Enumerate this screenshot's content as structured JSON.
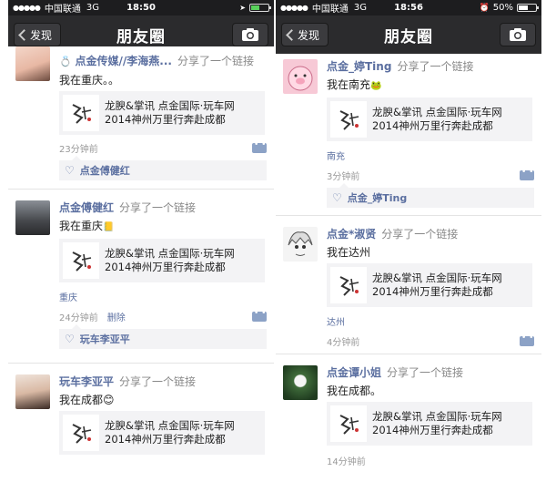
{
  "left": {
    "status": {
      "carrier": "中国联通",
      "network": "3G",
      "time": "18:50",
      "battery_level": 0.5
    },
    "nav": {
      "back": "发现",
      "title": "朋友圈"
    },
    "posts": [
      {
        "nick": "点金传媒//李海燕...",
        "action": "分享了一个链接",
        "text": "我在重庆。。",
        "link": "龙腴&掌讯 点金国际·玩车网 2014神州万里行奔赴成都",
        "location": "",
        "time": "23分钟前",
        "delete": "",
        "likes": "点金傅健红"
      },
      {
        "nick": "点金傅健红",
        "action": "分享了一个链接",
        "text": "我在重庆",
        "link": "龙腴&掌讯 点金国际·玩车网 2014神州万里行奔赴成都",
        "location": "重庆",
        "time": "24分钟前",
        "delete": "删除",
        "likes": "玩车李亚平"
      },
      {
        "nick": "玩车李亚平",
        "action": "分享了一个链接",
        "text": "我在成都😊",
        "link": "龙腴&掌讯 点金国际·玩车网 2014神州万里行奔赴成都",
        "location": "",
        "time": "",
        "delete": "",
        "likes": ""
      }
    ]
  },
  "right": {
    "status": {
      "carrier": "中国联通",
      "network": "3G",
      "time": "18:56",
      "battery": "50%"
    },
    "nav": {
      "back": "发现",
      "title": "朋友圈"
    },
    "posts": [
      {
        "nick": "点金_婷Ting",
        "action": "分享了一个链接",
        "text": "我在南充",
        "link": "龙腴&掌讯 点金国际·玩车网 2014神州万里行奔赴成都",
        "location": "南充",
        "time": "3分钟前",
        "likes": "点金_婷Ting"
      },
      {
        "nick": "点金*淑贤",
        "action": "分享了一个链接",
        "text": "我在达州",
        "link": "龙腴&掌讯 点金国际·玩车网 2014神州万里行奔赴成都",
        "location": "达州",
        "time": "4分钟前",
        "likes": ""
      },
      {
        "nick": "点金谭小姐",
        "action": "分享了一个链接",
        "text": "我在成都。",
        "link": "龙腴&掌讯 点金国际·玩车网 2014神州万里行奔赴成都",
        "location": "",
        "time": "14分钟前",
        "likes": ""
      }
    ]
  },
  "link_line1": "龙腴&掌讯 点金国际·玩车网",
  "link_line2": "2014神州万里行奔赴成都",
  "colors": {
    "nav": "#2b2b2d",
    "nick": "#5b6fa0",
    "card": "#f3f3f5"
  }
}
